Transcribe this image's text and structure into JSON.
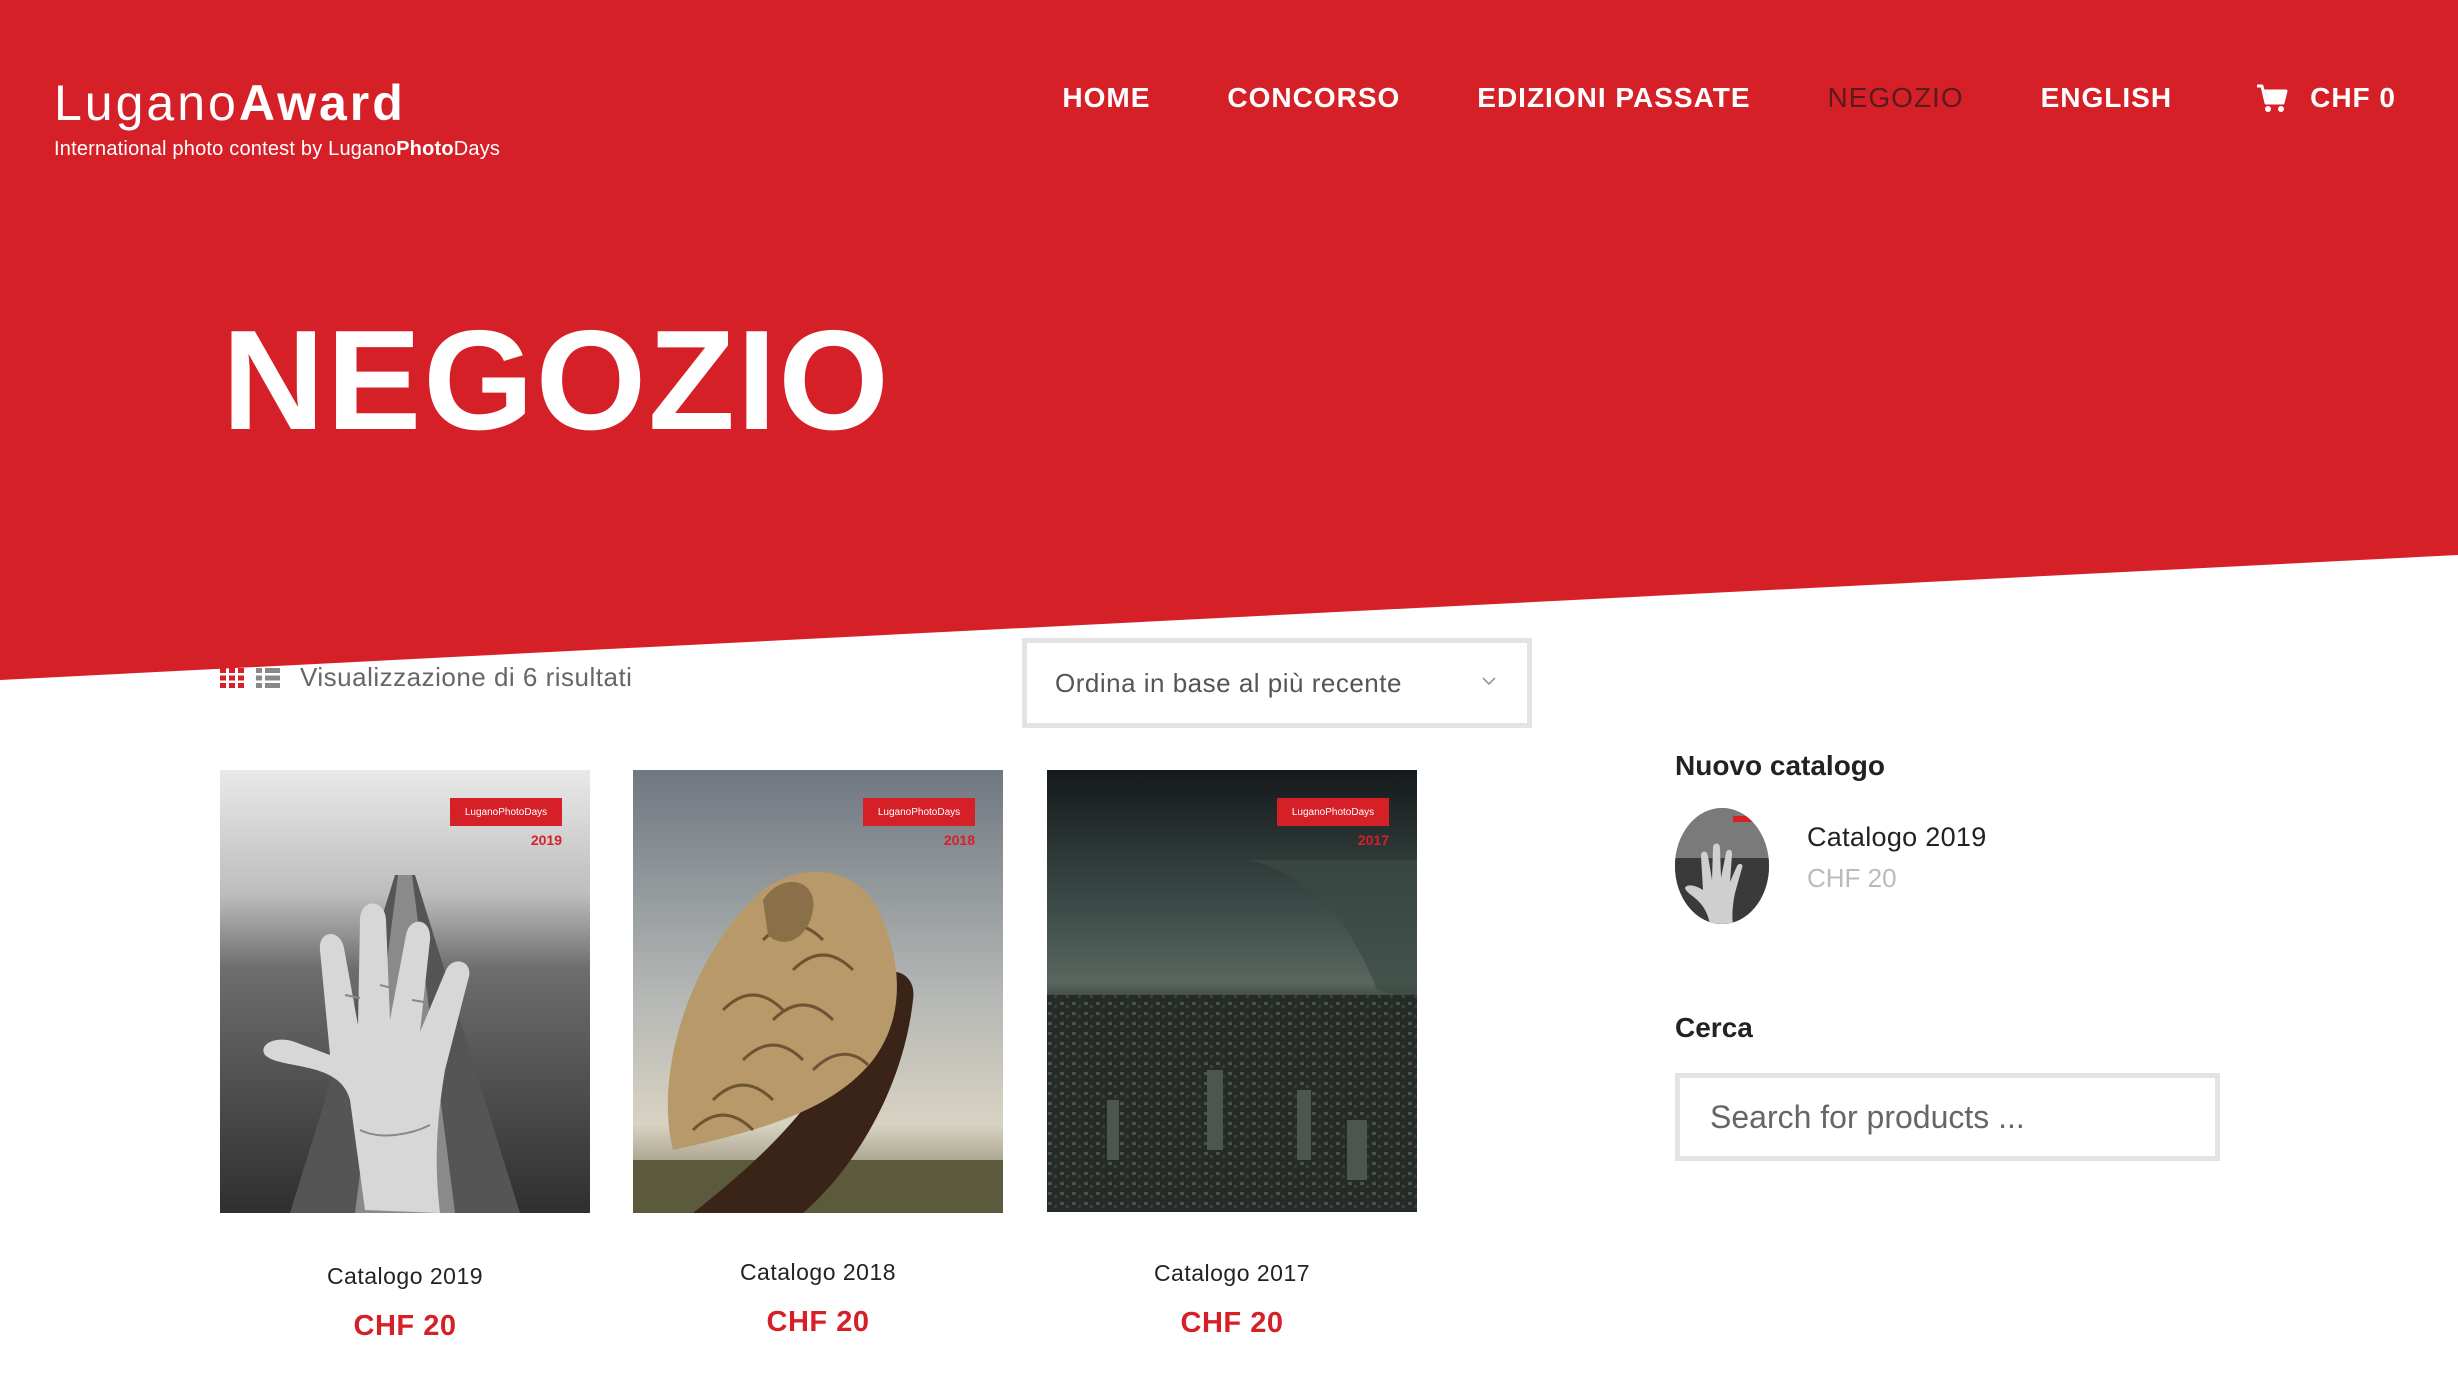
{
  "brand": {
    "name_light": "Lugano",
    "name_bold": "Award",
    "tagline_prefix": "International photo contest by Lugano",
    "tagline_bold": "Photo",
    "tagline_suffix": "Days"
  },
  "nav": {
    "items": [
      {
        "label": "HOME",
        "active": false
      },
      {
        "label": "CONCORSO",
        "active": false
      },
      {
        "label": "EDIZIONI PASSATE",
        "active": false
      },
      {
        "label": "NEGOZIO",
        "active": true
      },
      {
        "label": "ENGLISH",
        "active": false
      }
    ],
    "cart_total": "CHF 0",
    "cart_icon": "shopping-cart-icon"
  },
  "page": {
    "title": "NEGOZIO"
  },
  "toolbar": {
    "grid_icon": "grid-view-icon",
    "list_icon": "list-view-icon",
    "result_count": "Visualizzazione di 6 risultati",
    "sort_value": "Ordina in base al più recente"
  },
  "products": [
    {
      "name": "Catalogo 2019",
      "price": "CHF 20",
      "cover_badge": "LuganoPhotoDays",
      "cover_year": "2019"
    },
    {
      "name": "Catalogo 2018",
      "price": "CHF 20",
      "cover_badge": "LuganoPhotoDays",
      "cover_year": "2018"
    },
    {
      "name": "Catalogo 2017",
      "price": "CHF 20",
      "cover_badge": "LuganoPhotoDays",
      "cover_year": "2017"
    }
  ],
  "sidebar": {
    "new_catalog_title": "Nuovo catalogo",
    "new_catalog_item": {
      "name": "Catalogo 2019",
      "price": "CHF 20"
    },
    "search_title": "Cerca",
    "search_placeholder": "Search for products ..."
  },
  "colors": {
    "brand_red": "#d62028",
    "active_nav": "#5a1a1e"
  }
}
